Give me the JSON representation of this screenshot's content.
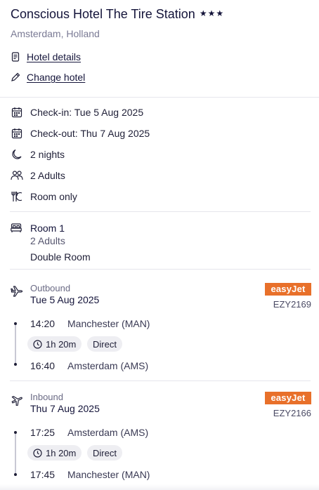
{
  "hotel": {
    "name": "Conscious Hotel The Tire Station",
    "stars": "★★★",
    "location": "Amsterdam, Holland",
    "details_link": "Hotel details",
    "change_link": "Change hotel"
  },
  "stay": {
    "checkin": "Check-in: Tue 5 Aug 2025",
    "checkout": "Check-out: Thu 7 Aug 2025",
    "nights": "2 nights",
    "guests": "2 Adults",
    "board": "Room only"
  },
  "room": {
    "title": "Room 1",
    "adults": "2 Adults",
    "type": "Double Room"
  },
  "outbound": {
    "direction": "Outbound",
    "date": "Tue 5 Aug 2025",
    "airline": "easyJet",
    "flight_number": "EZY2169",
    "depart_time": "14:20",
    "depart_airport": "Manchester (MAN)",
    "duration": "1h 20m",
    "stops": "Direct",
    "arrive_time": "16:40",
    "arrive_airport": "Amsterdam (AMS)"
  },
  "inbound": {
    "direction": "Inbound",
    "date": "Thu 7 Aug 2025",
    "airline": "easyJet",
    "flight_number": "EZY2166",
    "depart_time": "17:25",
    "depart_airport": "Amsterdam (AMS)",
    "duration": "1h 20m",
    "stops": "Direct",
    "arrive_time": "17:45",
    "arrive_airport": "Manchester (MAN)"
  },
  "colors": {
    "airline_brand": "#e8702a",
    "text_primary": "#14143a",
    "muted": "#7a7a94"
  }
}
